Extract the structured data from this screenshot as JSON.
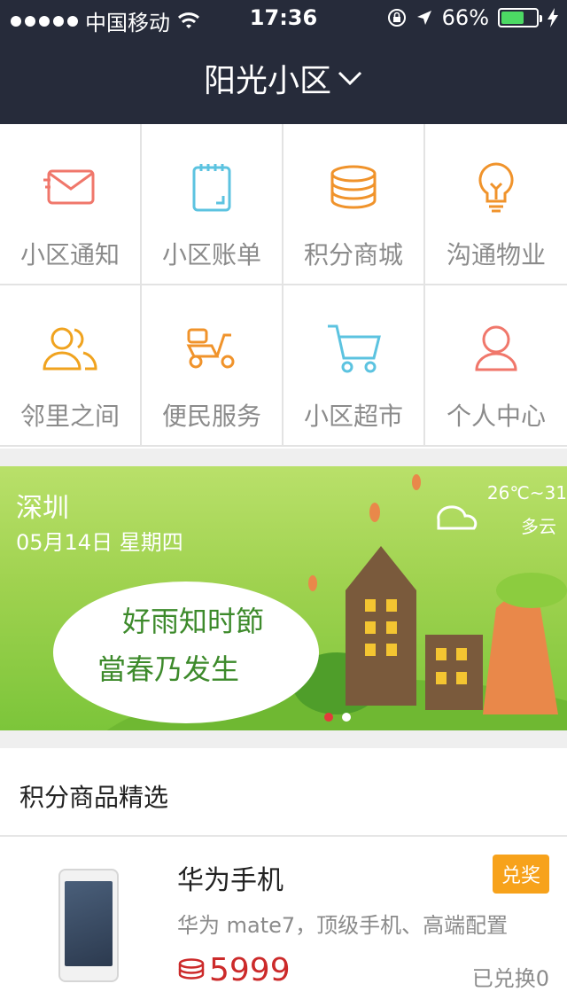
{
  "status_bar": {
    "carrier": "中国移动",
    "time": "17:36",
    "battery": "66%",
    "battery_fraction": 0.66,
    "icons": [
      "signal-dots-icon",
      "wifi-icon",
      "rotation-lock-icon",
      "location-arrow-icon",
      "battery-icon",
      "charging-bolt-icon"
    ]
  },
  "header": {
    "title": "阳光小区",
    "dropdown_icon": "chevron-down-icon"
  },
  "grid": {
    "items": [
      {
        "label": "小区通知",
        "icon": "envelope-icon",
        "color": "#f0776b"
      },
      {
        "label": "小区账单",
        "icon": "notepad-icon",
        "color": "#5cc3e0"
      },
      {
        "label": "积分商城",
        "icon": "coins-stack-icon",
        "color": "#f0932b"
      },
      {
        "label": "沟通物业",
        "icon": "lightbulb-icon",
        "color": "#f0932b"
      },
      {
        "label": "邻里之间",
        "icon": "people-icon",
        "color": "#f0a31f"
      },
      {
        "label": "便民服务",
        "icon": "scooter-icon",
        "color": "#f0932b"
      },
      {
        "label": "小区超市",
        "icon": "shopping-cart-icon",
        "color": "#5cc3e0"
      },
      {
        "label": "个人中心",
        "icon": "person-icon",
        "color": "#f0776b"
      }
    ]
  },
  "banner": {
    "city": "深圳",
    "date": "05月14日  星期四",
    "temperature": "26℃~31",
    "weather": "多云",
    "poem_line1": "好雨知时節",
    "poem_line2": "當春乃发生",
    "pages": 2,
    "active_page": 1
  },
  "points_section": {
    "title": "积分商品精选",
    "products": [
      {
        "name": "华为手机",
        "description": "华为 mate7，顶级手机、高端配置",
        "price": "5999",
        "badge": "兑奖",
        "redeemed": "已兑换0"
      }
    ]
  },
  "colors": {
    "header_bg": "#262b3a",
    "price_red": "#cc2a2a",
    "badge_orange": "#f7a21b"
  }
}
